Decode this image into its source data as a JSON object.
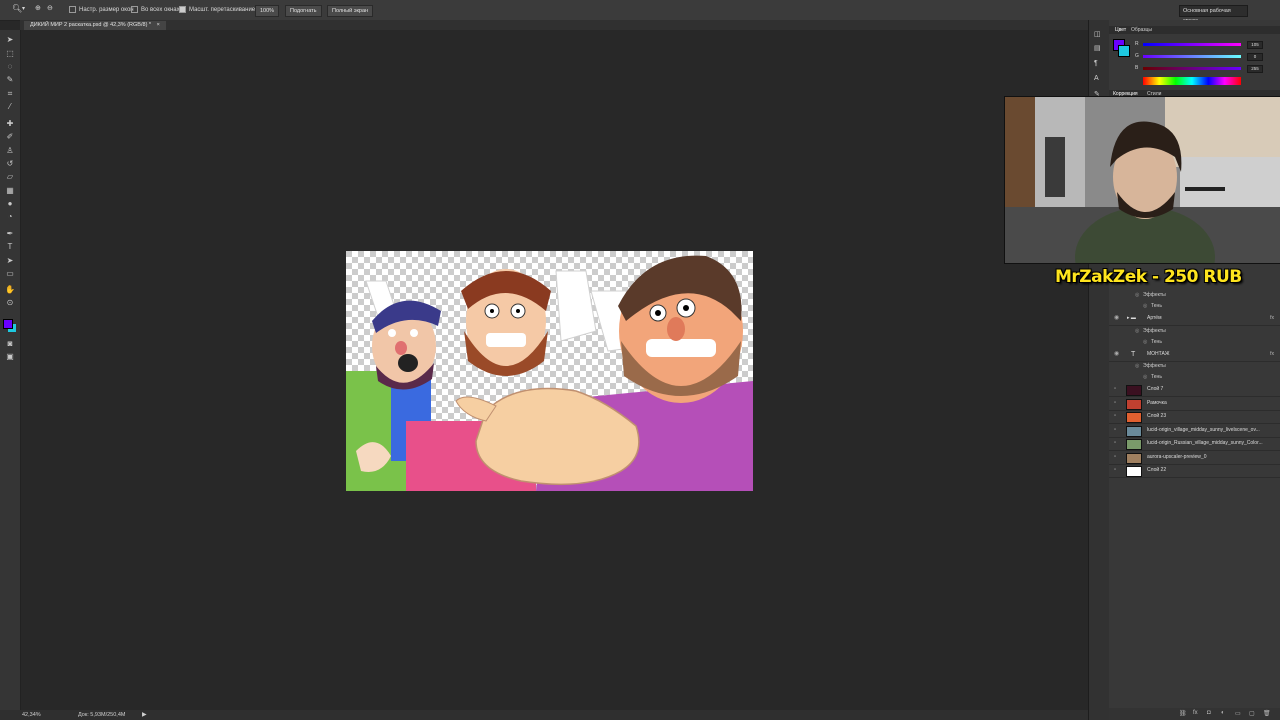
{
  "options_bar": {
    "resize_windows_label": "Настр. размер окон",
    "all_windows_label": "Во всех окнах",
    "scrubby_zoom_label": "Масшт. перетаскиванием",
    "zoom_button": "100%",
    "fit_button": "Подогнать",
    "fullscreen_button": "Полный экран",
    "workspace_label": "Основная рабочая среда"
  },
  "document_tab": {
    "title": "ДИКИЙ МИР 2 раскатка.psd @ 42,3% (RGB/8) *",
    "close": "×"
  },
  "status_bar": {
    "zoom": "42,34%",
    "doc_size": "Док: 5,93М/250,4М",
    "arrow": "▶"
  },
  "color_panel": {
    "tab_color": "Цвет",
    "tab_swatches": "Образцы",
    "r_label": "R",
    "g_label": "G",
    "b_label": "B",
    "r_value": "105",
    "g_value": "0",
    "b_value": "255",
    "foreground_color": "#6900ff",
    "background_color": "#1ec8e0"
  },
  "adjustments_panel": {
    "tab_correction": "Коррекция",
    "tab_styles": "Стили"
  },
  "layers": [
    {
      "indent": "sub",
      "label": "Эффекты"
    },
    {
      "indent": "subsub",
      "label": "Тень"
    },
    {
      "type": "group",
      "name": "Артём",
      "fx": "fx"
    },
    {
      "indent": "sub",
      "label": "Эффекты"
    },
    {
      "indent": "subsub",
      "label": "Тень"
    },
    {
      "type": "text",
      "name": "МОНТАЖ",
      "fx": "fx"
    },
    {
      "indent": "sub",
      "label": "Эффекты"
    },
    {
      "indent": "subsub",
      "label": "Тень"
    },
    {
      "type": "pixel",
      "name": "Слой 7",
      "thumb": "#3a1020"
    },
    {
      "type": "pixel",
      "name": "Рамочка",
      "thumb": "#c04030"
    },
    {
      "type": "pixel",
      "name": "Слой 23",
      "thumb": "#e06030"
    },
    {
      "type": "pixel",
      "name": "lucid-origin_village_midday_sunny_livelscene_ov...",
      "thumb": "#6a8a9a"
    },
    {
      "type": "pixel",
      "name": "lucid-origin_Russian_village_midday_sunny_Color...",
      "thumb": "#7a9a6a"
    },
    {
      "type": "pixel",
      "name": "aurora-upscaler-preview_0",
      "thumb": "#a08060"
    },
    {
      "type": "pixel",
      "name": "Слой 22",
      "thumb": "#ffffff"
    }
  ],
  "overlay": {
    "donation_text": "MrZakZek - 250 RUB"
  },
  "colors": {
    "app_bg": "#282828",
    "panel_bg": "#383838",
    "donation": "#ffe51e"
  }
}
